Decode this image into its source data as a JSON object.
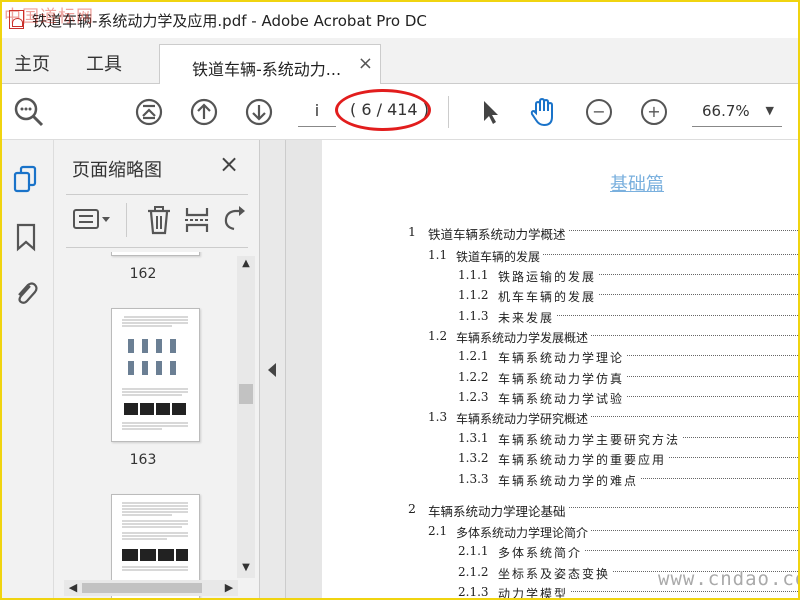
{
  "window": {
    "title": "铁道车辆-系统动力学及应用.pdf - Adobe Acrobat Pro DC",
    "watermark_top": "中国道标网"
  },
  "nav": {
    "home": "主页",
    "tools": "工具",
    "doc_tab": "铁道车辆-系统动力...",
    "close_tab": "×"
  },
  "toolbar": {
    "page_input": "i",
    "page_count": "( 6 / 414 )",
    "zoom": "66.7%",
    "zoom_caret": "▼",
    "minus": "−",
    "plus": "+"
  },
  "thumbnail_panel": {
    "title": "页面缩略图",
    "close": "×",
    "pages": [
      "162",
      "163"
    ]
  },
  "document": {
    "heading": "基础篇",
    "toc": [
      {
        "num": "1",
        "text": "铁道车辆系统动力学概述",
        "level": 1
      },
      {
        "num": "1.1",
        "text": "铁道车辆的发展",
        "level": 2
      },
      {
        "num": "1.1.1",
        "text": "铁路运输的发展",
        "level": 3
      },
      {
        "num": "1.1.2",
        "text": "机车车辆的发展",
        "level": 3
      },
      {
        "num": "1.1.3",
        "text": "未来发展",
        "level": 3
      },
      {
        "num": "1.2",
        "text": "车辆系统动力学发展概述",
        "level": 2
      },
      {
        "num": "1.2.1",
        "text": "车辆系统动力学理论",
        "level": 3
      },
      {
        "num": "1.2.2",
        "text": "车辆系统动力学仿真",
        "level": 3
      },
      {
        "num": "1.2.3",
        "text": "车辆系统动力学试验",
        "level": 3
      },
      {
        "num": "1.3",
        "text": "车辆系统动力学研究概述",
        "level": 2
      },
      {
        "num": "1.3.1",
        "text": "车辆系统动力学主要研究方法",
        "level": 3
      },
      {
        "num": "1.3.2",
        "text": "车辆系统动力学的重要应用",
        "level": 3
      },
      {
        "num": "1.3.3",
        "text": "车辆系统动力学的难点",
        "level": 3
      },
      {
        "num": "2",
        "text": "车辆系统动力学理论基础",
        "level": 1
      },
      {
        "num": "2.1",
        "text": "多体系统动力学理论简介",
        "level": 2
      },
      {
        "num": "2.1.1",
        "text": "多体系统简介",
        "level": 3
      },
      {
        "num": "2.1.2",
        "text": "坐标系及姿态变换",
        "level": 3
      },
      {
        "num": "2.1.3",
        "text": "动力学模型",
        "level": 3
      }
    ],
    "watermark_bottom": "www.cndao.com"
  }
}
